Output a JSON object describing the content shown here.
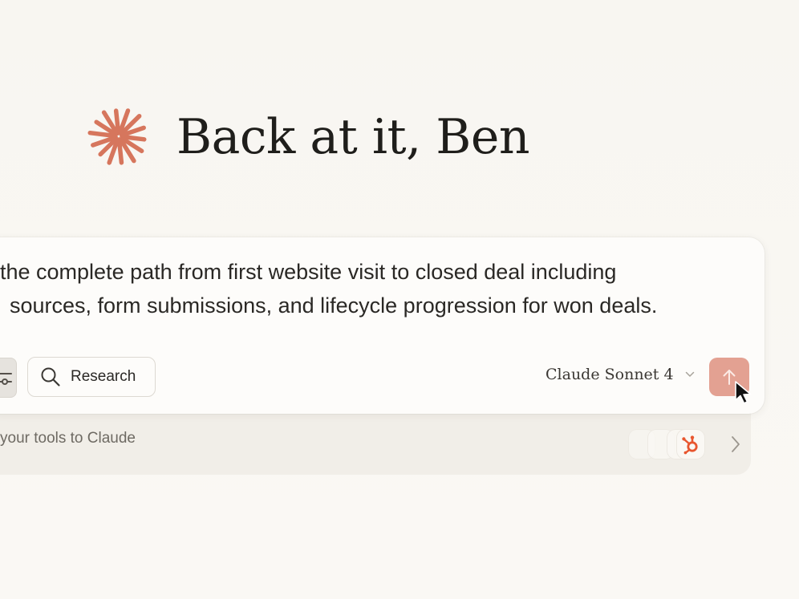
{
  "greeting": {
    "text": "Back at it, Ben"
  },
  "composer": {
    "prompt_line_1": "the complete path from first website visit to closed deal including",
    "prompt_line_2": "sources, form submissions, and lifecycle progression for won deals.",
    "research_label": "Research",
    "model_label": "Claude Sonnet 4"
  },
  "tools_tray": {
    "text": "your tools to Claude",
    "chips": [
      "blank",
      "blank",
      "blank",
      "hubspot-icon"
    ]
  },
  "colors": {
    "background": "#f9f7f3",
    "brand_accent": "#d6765d",
    "send_button": "#e3a192",
    "hubspot": "#e8562f"
  }
}
